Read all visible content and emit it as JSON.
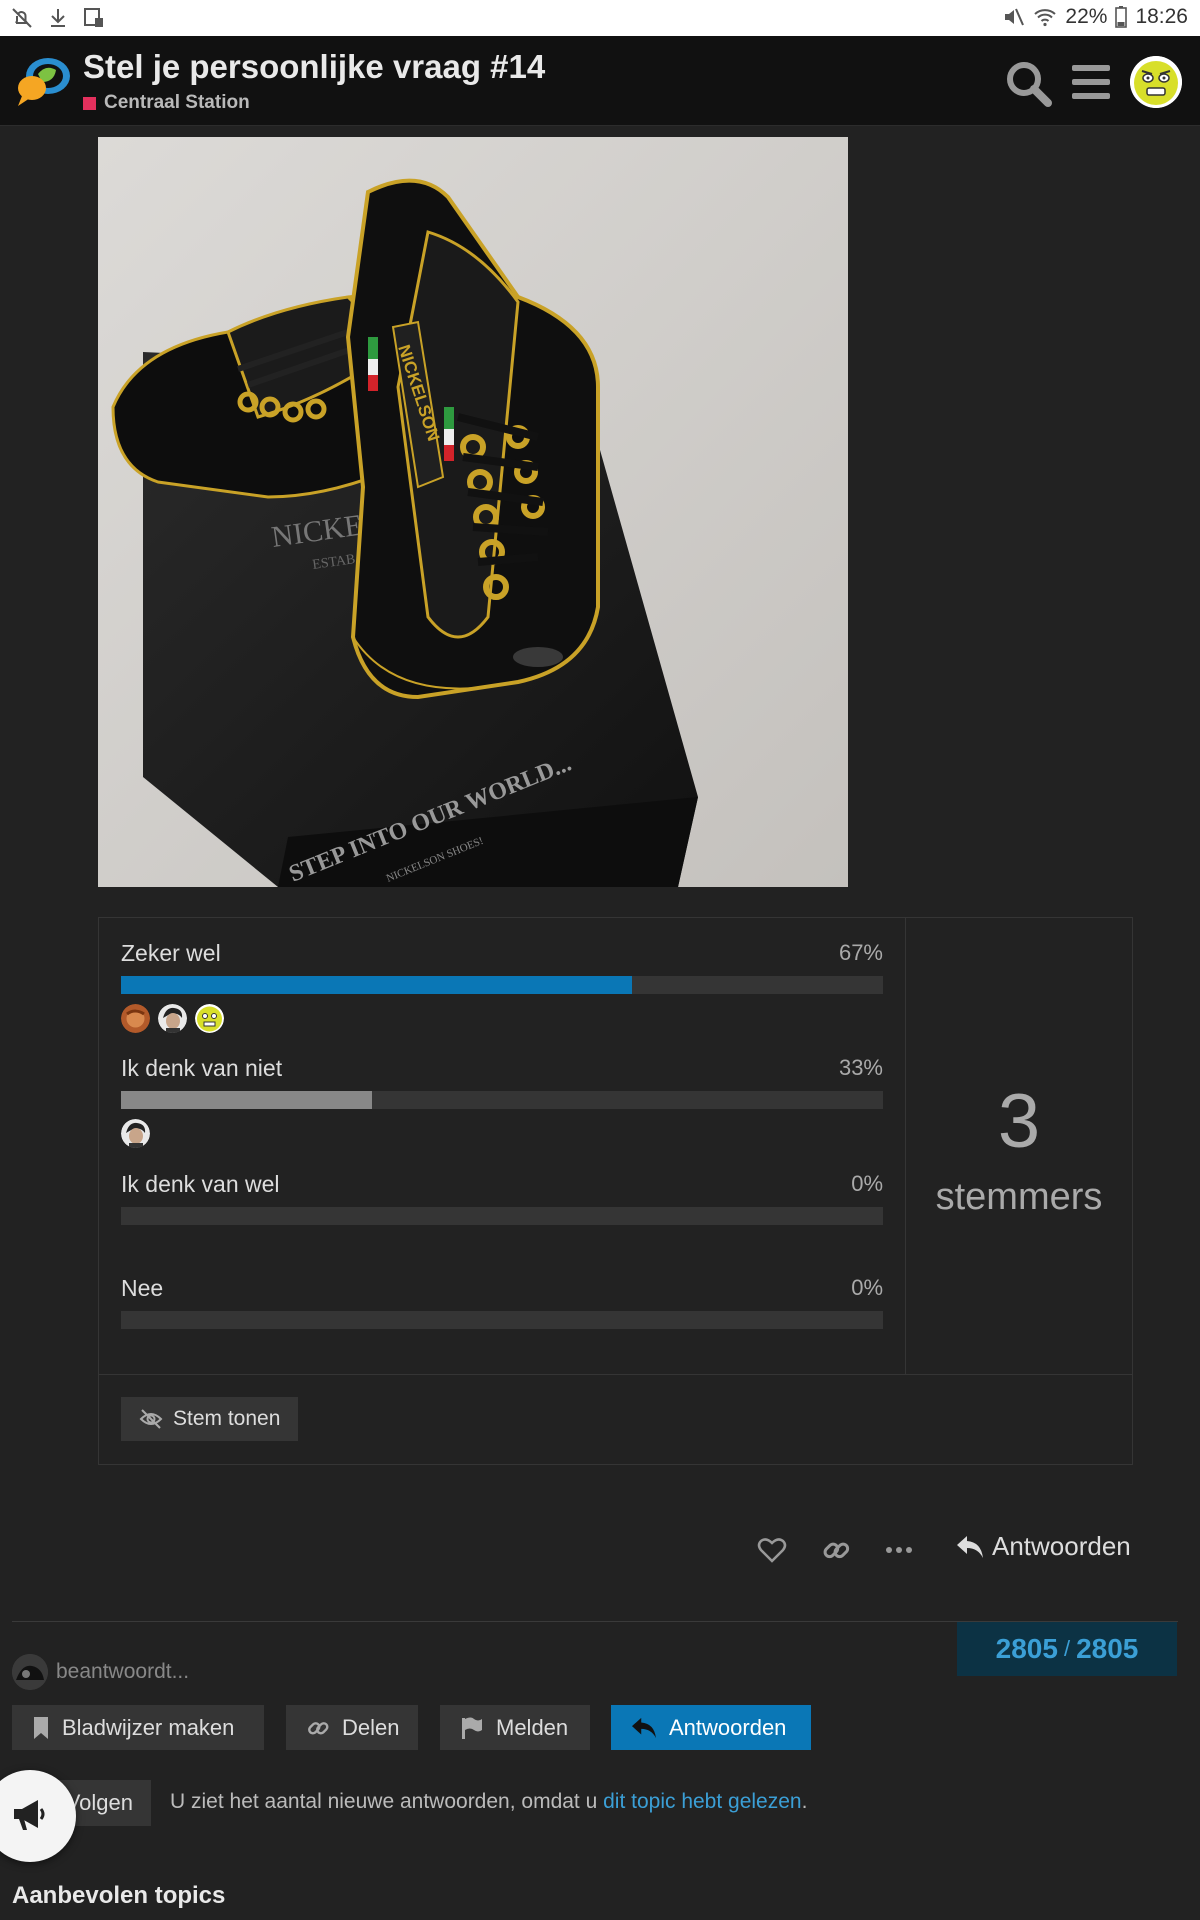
{
  "status_bar": {
    "battery": "22%",
    "time": "18:26"
  },
  "header": {
    "title": "Stel je persoonlijke vraag #14",
    "category": "Centraal Station",
    "category_color": "#e4305d"
  },
  "post_image": {
    "box_text_1": "NICKE",
    "box_text_2": "ESTAB",
    "shoe_text": "NICKELSON",
    "box_slogan": "STEP INTO OUR WORLD...",
    "box_subslogan": "NICKELSON SHOES!"
  },
  "poll": {
    "options": [
      {
        "label": "Zeker wel",
        "percent": "67%",
        "fraction": 0.67,
        "fill_color": "#0a77b6",
        "voters": [
          "voter-avatar-1",
          "voter-avatar-2",
          "voter-avatar-3"
        ]
      },
      {
        "label": "Ik denk van niet",
        "percent": "33%",
        "fraction": 0.33,
        "fill_color": "#888888",
        "voters": [
          "voter-avatar-2"
        ]
      },
      {
        "label": "Ik denk van wel",
        "percent": "0%",
        "fraction": 0,
        "fill_color": "#888888",
        "voters": []
      },
      {
        "label": "Nee",
        "percent": "0%",
        "fraction": 0,
        "fill_color": "#888888",
        "voters": []
      }
    ],
    "voter_count": "3",
    "voter_label": "stemmers",
    "show_votes_label": "Stem tonen"
  },
  "post_actions": {
    "like_icon": "heart-icon",
    "link_icon": "link-icon",
    "more_icon": "ellipsis-icon",
    "reply_label": "Antwoorden"
  },
  "progress": {
    "current": "2805",
    "total": "2805"
  },
  "typing_indicator": "beantwoordt...",
  "footer_buttons": {
    "bookmark": "Bladwijzer maken",
    "share": "Delen",
    "flag": "Melden",
    "reply": "Antwoorden"
  },
  "notification": {
    "follow_label": "Volgen",
    "text": "U ziet het aantal nieuwe antwoorden, omdat u ",
    "link": "dit topic hebt gelezen",
    "suffix": "."
  },
  "suggested_title": "Aanbevolen topics",
  "colors": {
    "accent": "#0a77b6",
    "background": "#222222",
    "header": "#111111"
  }
}
